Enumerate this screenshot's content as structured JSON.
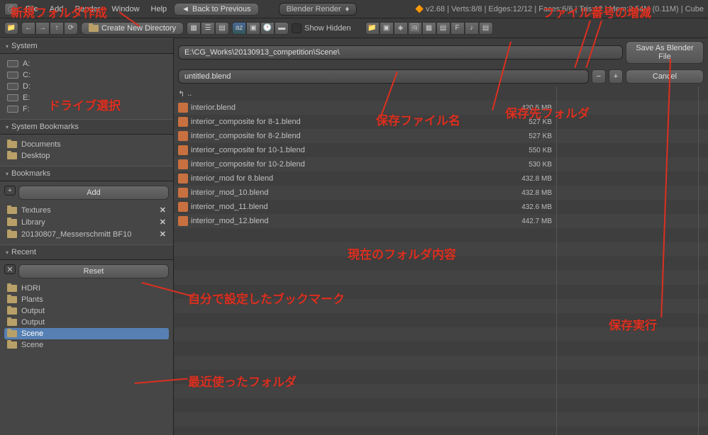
{
  "topbar": {
    "menus": [
      "File",
      "Add",
      "Render",
      "Window",
      "Help"
    ],
    "back_btn": "Back to Previous",
    "render_engine": "Blender Render",
    "stats": "v2.68 | Verts:8/8 | Edges:12/12 | Faces:6/6 | Tris:12 | Mem:9.54M (0.11M) | Cube"
  },
  "toolbar": {
    "create_dir": "Create New Directory",
    "show_hidden": "Show Hidden"
  },
  "path_input": "E:\\CG_Works\\20130913_competition\\Scene\\",
  "filename_input": "untitled.blend",
  "save_btn": "Save As Blender File",
  "cancel_btn": "Cancel",
  "sidebar": {
    "system": {
      "title": "System",
      "drives": [
        "A:",
        "C:",
        "D:",
        "E:",
        "F:"
      ]
    },
    "sys_bookmarks": {
      "title": "System Bookmarks",
      "items": [
        "Documents",
        "Desktop"
      ]
    },
    "bookmarks": {
      "title": "Bookmarks",
      "add_btn": "Add",
      "items": [
        "Textures",
        "Library",
        "20130807_Messerschmitt BF10"
      ]
    },
    "recent": {
      "title": "Recent",
      "reset_btn": "Reset",
      "items": [
        {
          "name": "HDRI",
          "sel": false
        },
        {
          "name": "Plants",
          "sel": false
        },
        {
          "name": "Output",
          "sel": false
        },
        {
          "name": "Output",
          "sel": false
        },
        {
          "name": "Scene",
          "sel": true
        },
        {
          "name": "Scene",
          "sel": false
        }
      ]
    }
  },
  "files": [
    {
      "name": "interior.blend",
      "size": "420.5 MB"
    },
    {
      "name": "interior_composite for 8-1.blend",
      "size": "527 KB"
    },
    {
      "name": "interior_composite for 8-2.blend",
      "size": "527 KB"
    },
    {
      "name": "interior_composite for 10-1.blend",
      "size": "550 KB"
    },
    {
      "name": "interior_composite for 10-2.blend",
      "size": "530 KB"
    },
    {
      "name": "interior_mod for 8.blend",
      "size": "432.8 MB"
    },
    {
      "name": "interior_mod_10.blend",
      "size": "432.8 MB"
    },
    {
      "name": "interior_mod_11.blend",
      "size": "432.6 MB"
    },
    {
      "name": "interior_mod_12.blend",
      "size": "442.7 MB"
    }
  ],
  "annotations": {
    "a1": "新規フォルダ作成",
    "a2": "ドライブ選択",
    "a3": "保存ファイル名",
    "a4": "保存先フォルダ",
    "a5": "ファイル番号の増減",
    "a6": "現在のフォルダ内容",
    "a7": "自分で設定したブックマーク",
    "a8": "最近使ったフォルダ",
    "a9": "保存実行"
  }
}
